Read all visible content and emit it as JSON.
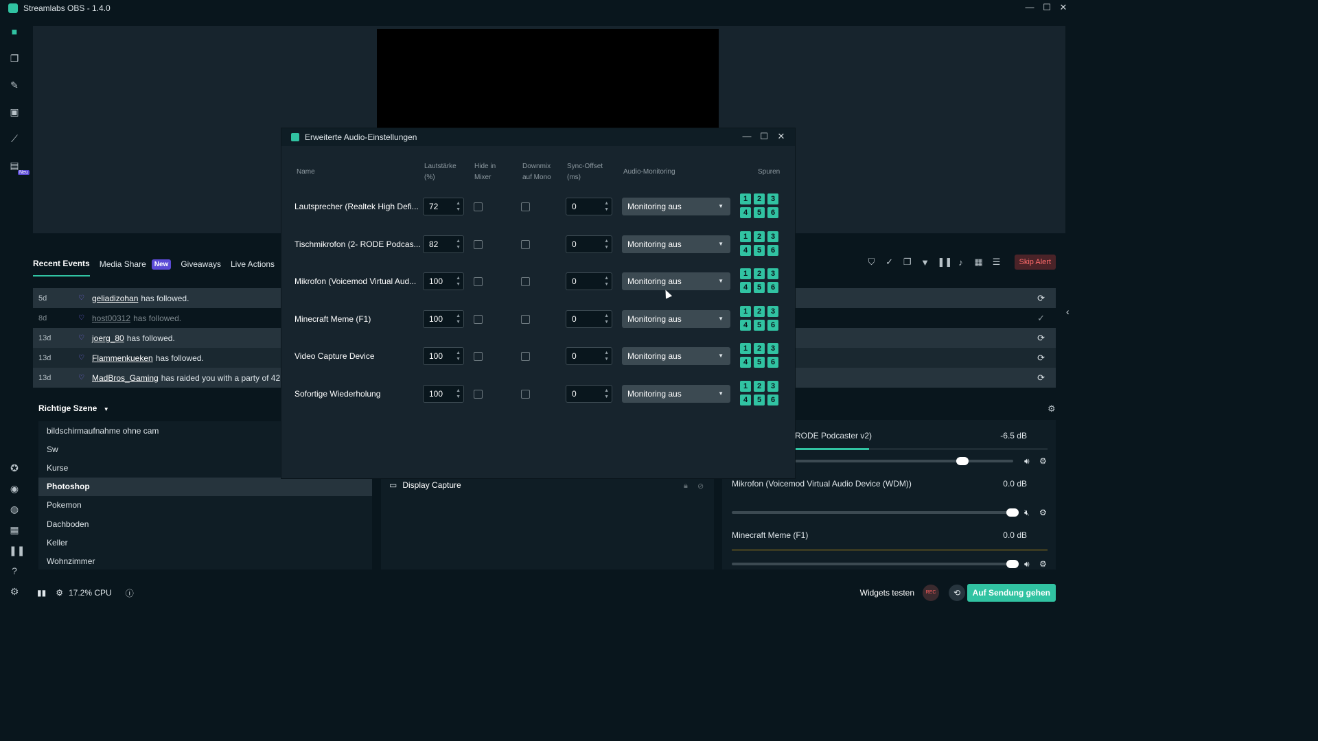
{
  "window": {
    "title": "Streamlabs OBS - 1.4.0"
  },
  "sidebar": {
    "neu_badge": "Neu"
  },
  "events": {
    "tabs": [
      {
        "label": "Recent Events"
      },
      {
        "label": "Media Share",
        "badge": "New"
      },
      {
        "label": "Giveaways"
      },
      {
        "label": "Live Actions"
      }
    ],
    "skip_alert": "Skip Alert",
    "rows": [
      {
        "age": "5d",
        "user": "geliadizohan",
        "msg": "has followed."
      },
      {
        "age": "8d",
        "user": "host00312",
        "msg": "has followed."
      },
      {
        "age": "13d",
        "user": "joerg_80",
        "msg": "has followed."
      },
      {
        "age": "13d",
        "user": "Flammenkueken",
        "msg": "has followed."
      },
      {
        "age": "13d",
        "user": "MadBros_Gaming",
        "msg": "has raided you with a party of 42."
      }
    ]
  },
  "scenes": {
    "header": "Richtige Szene",
    "items": [
      "bildschirmaufnahme ohne cam",
      "Sw",
      "Kurse",
      "Photoshop",
      "Pokemon",
      "Dachboden",
      "Keller",
      "Wohnzimmer"
    ]
  },
  "sources": {
    "item": "Display Capture"
  },
  "mixer": {
    "items": [
      {
        "name": "RODE Podcaster v2)",
        "db": "-6.5 dB",
        "level": 0.4
      },
      {
        "name": "Mikrofon (Voicemod Virtual Audio Device (WDM))",
        "db": "0.0 dB",
        "level": 1.0
      },
      {
        "name": "Minecraft Meme (F1)",
        "db": "0.0 dB",
        "level": 1.0
      }
    ]
  },
  "status": {
    "cpu": "17.2% CPU",
    "widgets_test": "Widgets testen",
    "rec": "REC",
    "go_live": "Auf Sendung gehen"
  },
  "modal": {
    "title": "Erweiterte Audio-Einstellungen",
    "columns": {
      "name": "Name",
      "volume": "Lautstärke\n(%)",
      "hide": "Hide in\nMixer",
      "downmix": "Downmix\nauf Mono",
      "sync": "Sync-Offset\n(ms)",
      "monitoring": "Audio-Monitoring",
      "tracks": "Spuren"
    },
    "rows": [
      {
        "name": "Lautsprecher (Realtek High Defi...",
        "volume": "72",
        "sync": "0",
        "monitoring": "Monitoring aus"
      },
      {
        "name": "Tischmikrofon (2- RODE Podcas...",
        "volume": "82",
        "sync": "0",
        "monitoring": "Monitoring aus"
      },
      {
        "name": "Mikrofon (Voicemod Virtual Aud...",
        "volume": "100",
        "sync": "0",
        "monitoring": "Monitoring aus"
      },
      {
        "name": "Minecraft Meme (F1)",
        "volume": "100",
        "sync": "0",
        "monitoring": "Monitoring aus"
      },
      {
        "name": "Video Capture Device",
        "volume": "100",
        "sync": "0",
        "monitoring": "Monitoring aus"
      },
      {
        "name": "Sofortige Wiederholung",
        "volume": "100",
        "sync": "0",
        "monitoring": "Monitoring aus"
      }
    ],
    "track_numbers": [
      "1",
      "2",
      "3",
      "4",
      "5",
      "6"
    ]
  },
  "colors": {
    "accent": "#31c3a2",
    "badge": "#5c4bd6",
    "skip": "#ff6b6b"
  }
}
